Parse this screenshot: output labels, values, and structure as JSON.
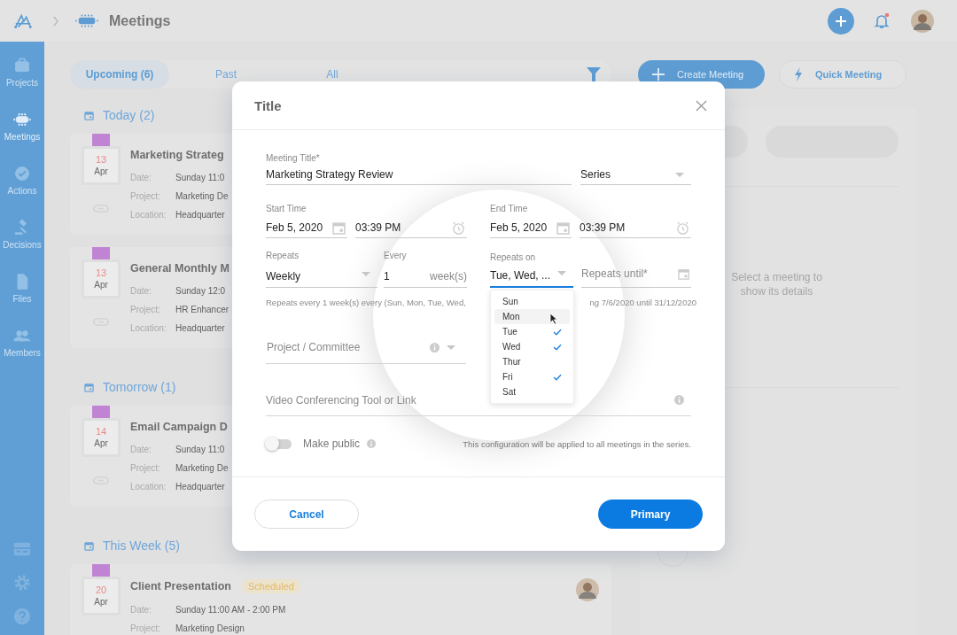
{
  "topbar": {
    "breadcrumb": "Meetings",
    "notification_unread": true
  },
  "sidebar": {
    "items": [
      {
        "label": "Projects",
        "selected": false
      },
      {
        "label": "Meetings",
        "selected": true
      },
      {
        "label": "Actions",
        "selected": false
      },
      {
        "label": "Decisions",
        "selected": false
      },
      {
        "label": "Files",
        "selected": false
      },
      {
        "label": "Members",
        "selected": false
      }
    ]
  },
  "tabs": [
    {
      "label": "Upcoming (6)",
      "selected": true
    },
    {
      "label": "Past",
      "selected": false
    },
    {
      "label": "All",
      "selected": false
    }
  ],
  "actions": [
    {
      "label": "Create Meeting",
      "kind": "primary"
    },
    {
      "label": "Quick Meeting",
      "kind": "outline"
    }
  ],
  "groups": [
    {
      "title": "Today (2)",
      "meetings": [
        {
          "day": "13",
          "month": "Apr",
          "title": "Marketing Strateg",
          "avatar": false,
          "rows": [
            {
              "label": "Date:",
              "value": "Sunday 11:0"
            },
            {
              "label": "Project:",
              "value": "Marketing De"
            },
            {
              "label": "Location:",
              "value": "Headquarter"
            }
          ]
        },
        {
          "day": "13",
          "month": "Apr",
          "title": "General Monthly M",
          "avatar": false,
          "rows": [
            {
              "label": "Date:",
              "value": "Sunday 12:0"
            },
            {
              "label": "Project:",
              "value": "HR Enhancer"
            },
            {
              "label": "Location:",
              "value": "Headquarter"
            }
          ]
        }
      ]
    },
    {
      "title": "Tomorrow (1)",
      "meetings": [
        {
          "day": "14",
          "month": "Apr",
          "title": "Email Campaign D",
          "avatar": false,
          "rows": [
            {
              "label": "Date:",
              "value": "Sunday 11:0"
            },
            {
              "label": "Project:",
              "value": "Marketing De"
            },
            {
              "label": "Location:",
              "value": "Headquarter"
            }
          ]
        }
      ]
    },
    {
      "title": "This Week (5)",
      "meetings": [
        {
          "day": "20",
          "month": "Apr",
          "title": "Client Presentation",
          "status": "Scheduled",
          "avatar": true,
          "rows": [
            {
              "label": "Date:",
              "value": "Sunday 11:00 AM - 2:00 PM"
            },
            {
              "label": "Project:",
              "value": "Marketing Design"
            }
          ]
        }
      ]
    }
  ],
  "details": {
    "empty_text": "Select a meeting to show its details"
  },
  "dialog": {
    "title": "Title",
    "meeting_title": {
      "label": "Meeting Title*",
      "value": "Marketing Strategy Review"
    },
    "series": {
      "value": "Series"
    },
    "start": {
      "label": "Start Time",
      "date": "Feb 5, 2020",
      "time": "03:39 PM"
    },
    "end": {
      "label": "End Time",
      "date": "Feb 5, 2020",
      "time": "03:39 PM"
    },
    "repeats": {
      "label": "Repeats",
      "value": "Weekly"
    },
    "every": {
      "label": "Every",
      "value": "1",
      "unit": "week(s)"
    },
    "repeats_on": {
      "label": "Repeats on",
      "value": "Tue, Wed, ...",
      "focused": true,
      "options": [
        {
          "label": "Sun",
          "checked": false,
          "highlighted": false
        },
        {
          "label": "Mon",
          "checked": false,
          "highlighted": true
        },
        {
          "label": "Tue",
          "checked": true,
          "highlighted": false
        },
        {
          "label": "Wed",
          "checked": true,
          "highlighted": false
        },
        {
          "label": "Thur",
          "checked": false,
          "highlighted": false
        },
        {
          "label": "Fri",
          "checked": true,
          "highlighted": false
        },
        {
          "label": "Sat",
          "checked": false,
          "highlighted": false
        }
      ]
    },
    "repeats_until": {
      "placeholder": "Repeats until*"
    },
    "summary": [
      "Repeats every 1 week(s) every (Sun, Mon, Tue, Wed,",
      "ng 7/6/2020 until 31/12/2020"
    ],
    "project": {
      "placeholder": "Project / Committee"
    },
    "video": {
      "placeholder": "Video Conferencing Tool or Link"
    },
    "make_public": {
      "label": "Make public",
      "on": false
    },
    "note": "This configuration will be applied to all meetings in the series.",
    "buttons": [
      {
        "label": "Cancel",
        "kind": "secondary"
      },
      {
        "label": "Primary",
        "kind": "primary"
      }
    ]
  }
}
